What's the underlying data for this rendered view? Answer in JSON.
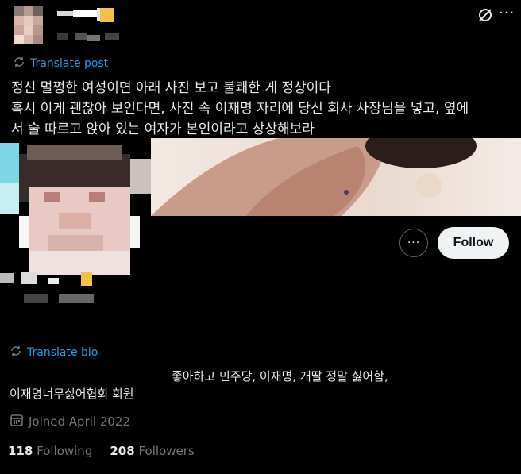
{
  "header": {
    "more_label": "···"
  },
  "post": {
    "translate_label": "Translate post",
    "lines": [
      "정신 멀쩡한 여성이면 아래 사진 보고 불쾌한 게 정상이다",
      "혹시 이게 괜찮아 보인다면, 사진 속 이재명 자리에 당신 회사 사장님을 넣고, 옆에",
      "서 술 따르고 앉아 있는 여자가 본인이라고 상상해보라"
    ]
  },
  "profile": {
    "more_label": "···",
    "follow_label": "Follow",
    "translate_bio_label": "Translate bio",
    "bio_line1": "좋아하고 민주당, 이재명, 개딸 정말 싫어함,",
    "bio_line2": "이재명너무싫어협회 회원",
    "joined": "Joined April 2022",
    "following_count": "118",
    "following_label": "Following",
    "followers_count": "208",
    "followers_label": "Followers"
  },
  "icons": {
    "translate": "translate-icon",
    "calendar": "calendar-icon",
    "grok": "grok-icon",
    "more": "more-icon"
  },
  "colors": {
    "background": "#000000",
    "text": "#e7e9ea",
    "muted": "#71767b",
    "link": "#1d9bf0",
    "follow_bg": "#eff3f4"
  }
}
